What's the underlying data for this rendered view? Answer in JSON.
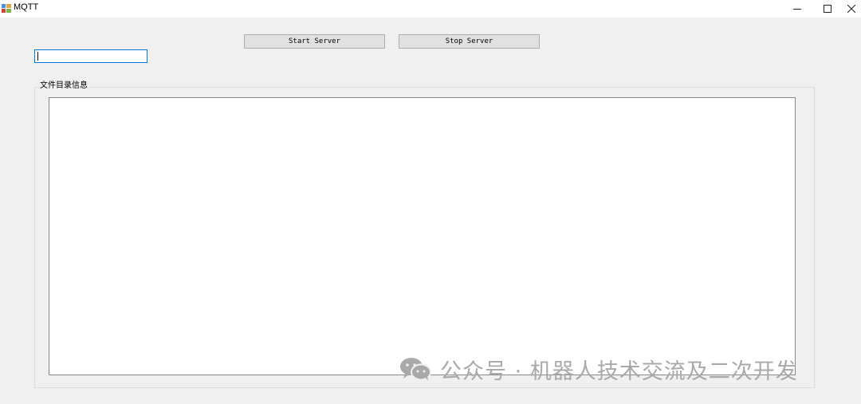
{
  "window": {
    "title": "MQTT",
    "icon": "app-icon",
    "controls": [
      "minimize-icon",
      "maximize-icon",
      "close-icon"
    ]
  },
  "toolbar": {
    "start_label": "Start Server",
    "stop_label": "Stop Server"
  },
  "input": {
    "value": ""
  },
  "group": {
    "label": "文件目录信息",
    "content": ""
  },
  "watermark": {
    "icon": "wechat-icon",
    "text": "公众号 · 机器人技术交流及二次开发"
  }
}
